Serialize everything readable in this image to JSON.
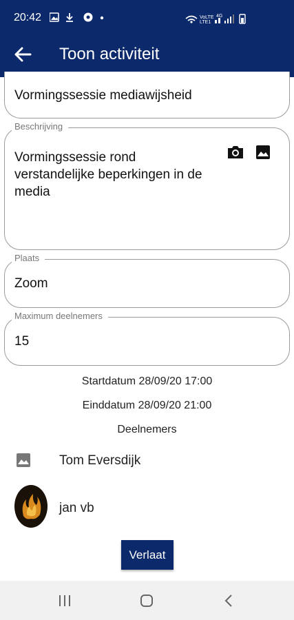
{
  "status_bar": {
    "time": "20:42"
  },
  "app_bar": {
    "title": "Toon activiteit"
  },
  "form": {
    "name": {
      "value": "Vormingssessie mediawijsheid"
    },
    "description": {
      "label": "Beschrijving",
      "lines": [
        "Vormingssessie rond",
        "verstandelijke beperkingen in de",
        "media"
      ]
    },
    "location": {
      "label": "Plaats",
      "value": "Zoom"
    },
    "max_participants": {
      "label": "Maximum deelnemers",
      "value": "15"
    }
  },
  "dates": {
    "start": "Startdatum 28/09/20 17:00",
    "end": "Einddatum 28/09/20 21:00"
  },
  "participants": {
    "heading": "Deelnemers",
    "items": [
      {
        "name": "Tom Eversdijk",
        "avatar": "image-placeholder-icon"
      },
      {
        "name": "jan vb",
        "avatar": "avatar"
      }
    ]
  },
  "actions": {
    "leave_label": "Verlaat"
  },
  "colors": {
    "primary": "#0c2a6b",
    "nav_bg": "#f1f1f1"
  }
}
